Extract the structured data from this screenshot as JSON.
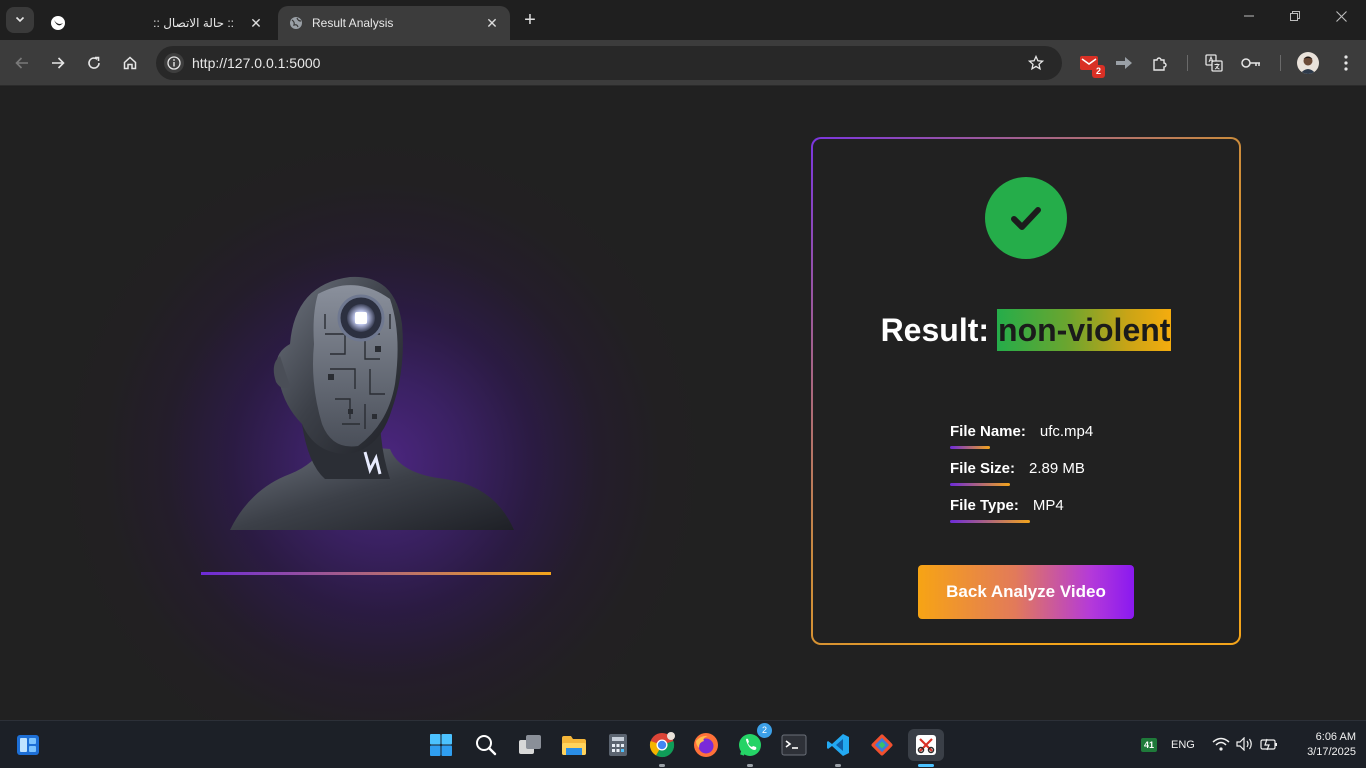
{
  "browser": {
    "tabs": [
      {
        "title": ":: حالة الاتصال ::",
        "favicon": "crescent-logo-icon",
        "active": false
      },
      {
        "title": "Result Analysis",
        "favicon": "globe-icon",
        "active": true
      }
    ],
    "url": "http://127.0.0.1:5000",
    "extensions": [
      {
        "name": "gmail-extension-icon",
        "badge": "2"
      },
      {
        "name": "forward-arrow-extension-icon"
      },
      {
        "name": "puzzle-extensions-icon"
      },
      {
        "name": "translate-icon"
      },
      {
        "name": "password-key-icon"
      }
    ]
  },
  "result": {
    "label": "Result:",
    "value": "non-violent",
    "status_color": "#25ad4a"
  },
  "file_info": {
    "name_label": "File Name:",
    "name_value": "ufc.mp4",
    "size_label": "File Size:",
    "size_value": "2.89 MB",
    "type_label": "File Type:",
    "type_value": "MP4"
  },
  "actions": {
    "back_label": "Back Analyze Video"
  },
  "taskbar": {
    "apps": [
      "widgets-icon",
      "start-icon",
      "search-icon",
      "task-view-icon",
      "file-explorer-icon",
      "calculator-icon",
      "chrome-icon",
      "firefox-icon",
      "whatsapp-icon",
      "terminal-icon",
      "vscode-icon",
      "git-icon",
      "snipping-tool-icon"
    ],
    "whatsapp_badge": "2",
    "tray_badge": "41",
    "language": "ENG",
    "time": "6:06 AM",
    "date": "3/17/2025"
  },
  "colors": {
    "accent_purple": "#6d2bd9",
    "accent_orange": "#f3a41b",
    "success_green": "#25ad4a"
  }
}
